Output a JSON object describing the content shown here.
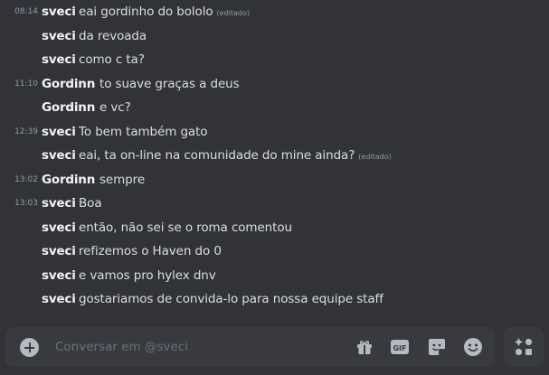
{
  "chat": {
    "messages": [
      {
        "time": "08:14",
        "author": "sveci",
        "text": "eai gordinho do bololo",
        "edited": "(editado)"
      },
      {
        "time": "",
        "author": "sveci",
        "text": "da revoada",
        "edited": ""
      },
      {
        "time": "",
        "author": "sveci",
        "text": "como c ta?",
        "edited": ""
      },
      {
        "time": "11:10",
        "author": "Gordinn",
        "text": "to suave graças a deus",
        "edited": ""
      },
      {
        "time": "",
        "author": "Gordinn",
        "text": "e vc?",
        "edited": ""
      },
      {
        "time": "12:39",
        "author": "sveci",
        "text": "To bem também gato",
        "edited": ""
      },
      {
        "time": "",
        "author": "sveci",
        "text": "eai, ta on-line na comunidade do mine ainda?",
        "edited": "(editado)"
      },
      {
        "time": "13:02",
        "author": "Gordinn",
        "text": "sempre",
        "edited": ""
      },
      {
        "time": "13:03",
        "author": "sveci",
        "text": "Boa",
        "edited": ""
      },
      {
        "time": "",
        "author": "sveci",
        "text": "então, não sei se o roma comentou",
        "edited": ""
      },
      {
        "time": "",
        "author": "sveci",
        "text": "refizemos o Haven do 0",
        "edited": ""
      },
      {
        "time": "",
        "author": "sveci",
        "text": "e vamos pro hylex dnv",
        "edited": ""
      },
      {
        "time": "",
        "author": "sveci",
        "text": "gostariamos de convida-lo para nossa equipe staff",
        "edited": ""
      }
    ]
  },
  "composer": {
    "placeholder": "Conversar em @sveci",
    "value": "",
    "icons": [
      "add-icon",
      "gift-icon",
      "gif-icon",
      "sticker-icon",
      "emoji-icon",
      "apps-icon"
    ]
  },
  "colors": {
    "background": "#313338",
    "input_background": "#383a40",
    "author": "#f2f3f5",
    "text": "#dbdee1",
    "muted": "#949ba4",
    "icon": "#b5bac1"
  }
}
